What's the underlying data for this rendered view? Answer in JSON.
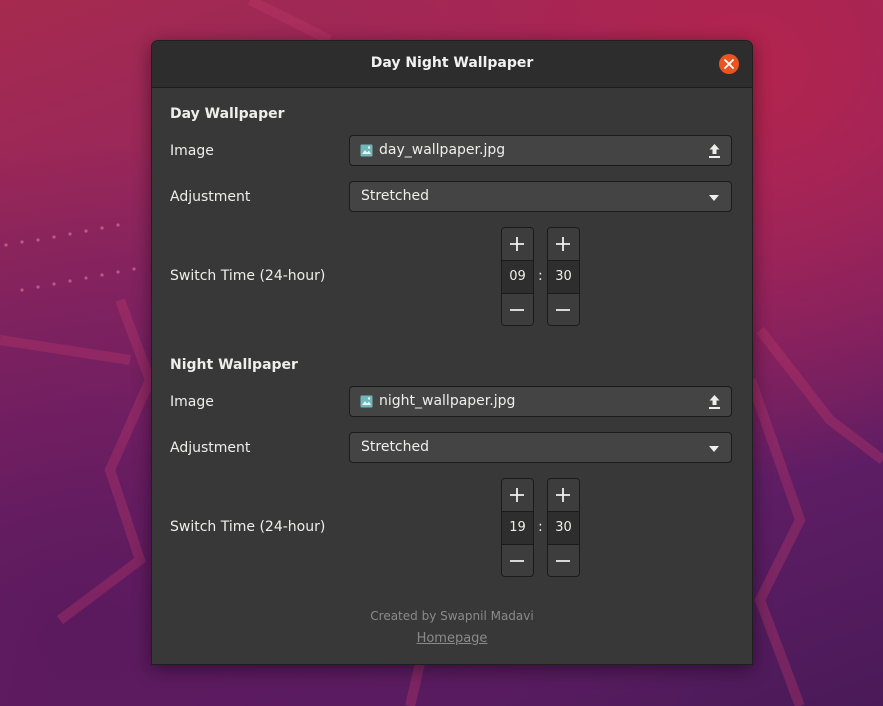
{
  "window": {
    "title": "Day Night Wallpaper"
  },
  "day": {
    "section_title": "Day Wallpaper",
    "image_label": "Image",
    "image_file": "day_wallpaper.jpg",
    "adjustment_label": "Adjustment",
    "adjustment_value": "Stretched",
    "switch_time_label": "Switch Time (24-hour)",
    "hour": "09",
    "minute": "30"
  },
  "night": {
    "section_title": "Night Wallpaper",
    "image_label": "Image",
    "image_file": "night_wallpaper.jpg",
    "adjustment_label": "Adjustment",
    "adjustment_value": "Stretched",
    "switch_time_label": "Switch Time (24-hour)",
    "hour": "19",
    "minute": "30"
  },
  "time_separator": ":",
  "footer": {
    "credit": "Created by Swapnil Madavi",
    "link": "Homepage"
  },
  "colors": {
    "accent": "#e95420",
    "window_bg": "#383838",
    "titlebar_bg": "#2d2d2d",
    "file_icon": "#6fb7b8"
  },
  "icons": {
    "close": "close-icon",
    "file": "image-file-icon",
    "upload": "upload-icon",
    "dropdown": "chevron-down-icon",
    "increment": "plus-icon",
    "decrement": "minus-icon"
  }
}
